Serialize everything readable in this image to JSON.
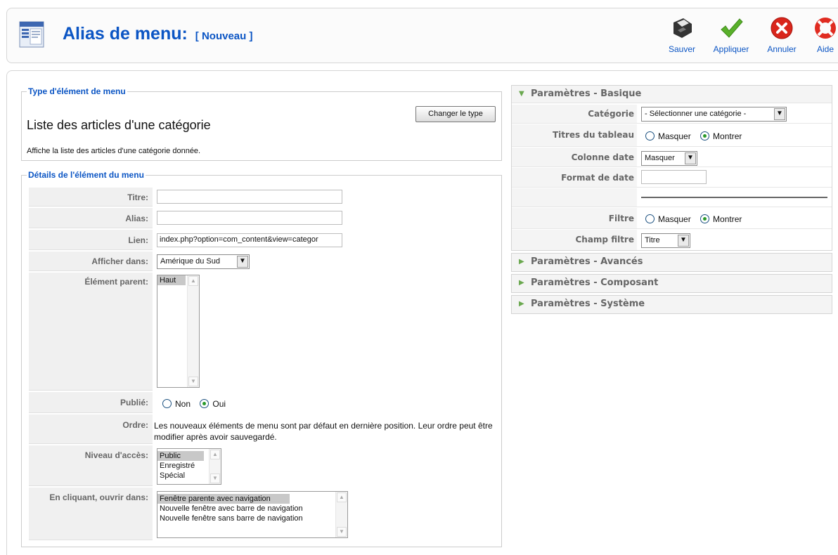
{
  "header": {
    "title": "Alias de menu:",
    "subtitle": "[ Nouveau ]",
    "title_icon": "menu-icon",
    "buttons": [
      {
        "label": "Sauver",
        "icon": "save-icon"
      },
      {
        "label": "Appliquer",
        "icon": "apply-icon"
      },
      {
        "label": "Annuler",
        "icon": "cancel-icon"
      },
      {
        "label": "Aide",
        "icon": "help-icon"
      }
    ]
  },
  "type_section": {
    "legend": "Type d'élément de menu",
    "heading": "Liste des articles d'une catégorie",
    "description": "Affiche la liste des articles d'une catégorie donnée.",
    "change_button": "Changer le type"
  },
  "details": {
    "legend": "Détails de l'élément du menu",
    "title_label": "Titre:",
    "title_value": "",
    "alias_label": "Alias:",
    "alias_value": "",
    "link_label": "Lien:",
    "link_value": "index.php?option=com_content&view=categor",
    "show_in_label": "Afficher dans:",
    "show_in_value": "Amérique du Sud",
    "parent_label": "Élément parent:",
    "parent_options": [
      "Haut"
    ],
    "published_label": "Publié:",
    "published_no": "Non",
    "published_yes": "Oui",
    "published_value": "Oui",
    "order_label": "Ordre:",
    "order_text": "Les nouveaux éléments de menu sont par défaut en dernière position. Leur ordre peut être modifier après avoir sauvegardé.",
    "access_label": "Niveau d'accès:",
    "access_options": [
      "Public",
      "Enregistré",
      "Spécial"
    ],
    "access_selected": "Public",
    "open_label": "En cliquant, ouvrir dans:",
    "open_options": [
      "Fenêtre parente avec navigation",
      "Nouvelle fenêtre avec barre de navigation",
      "Nouvelle fenêtre sans barre de navigation"
    ],
    "open_selected": "Fenêtre parente avec navigation"
  },
  "params": {
    "basic_title": "Paramètres - Basique",
    "category_label": "Catégorie",
    "category_value": "- Sélectionner une catégorie -",
    "table_titles_label": "Titres du tableau",
    "hide": "Masquer",
    "show": "Montrer",
    "table_titles_value": "Montrer",
    "date_col_label": "Colonne date",
    "date_col_value": "Masquer",
    "date_format_label": "Format de date",
    "date_format_value": "",
    "filter_label": "Filtre",
    "filter_value": "Montrer",
    "filter_field_label": "Champ filtre",
    "filter_field_value": "Titre",
    "advanced_title": "Paramètres - Avancés",
    "component_title": "Paramètres - Composant",
    "system_title": "Paramètres - Système"
  },
  "colors": {
    "accent": "#0B55C4",
    "label_gray": "#666666",
    "row_bg": "#F0F0F0"
  }
}
